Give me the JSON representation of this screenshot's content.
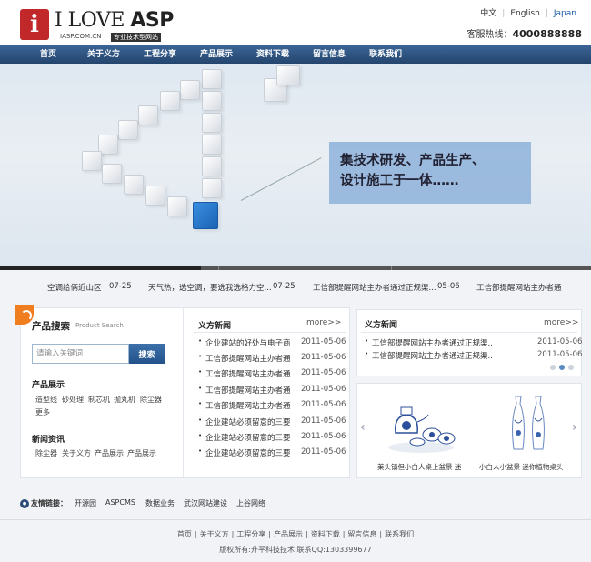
{
  "brand": {
    "logo_letter": "i",
    "logo_text_a": "I LOVE ",
    "logo_text_b": "ASP",
    "url": "IASP.COM.CN",
    "slogan": "专业技术型网站"
  },
  "languages": [
    "中文",
    "English",
    "Japan"
  ],
  "hotline": {
    "label": "客服热线：",
    "number": "4000888888"
  },
  "nav": [
    "首页",
    "关于义方",
    "工程分享",
    "产品展示",
    "资料下载",
    "留言信息",
    "联系我们"
  ],
  "banner": {
    "caption_line1": "集技术研发、产品生产、",
    "caption_line2": "设计施工于一体……",
    "progress": 0.34
  },
  "ticker": [
    {
      "t": "空调给俩近山区",
      "d": "07-25"
    },
    {
      "t": "天气热，选空调，要选我选格力空...",
      "d": "07-25"
    },
    {
      "t": "工信部提醒网站主办者通过正规渠...",
      "d": "05-06"
    },
    {
      "t": "工信部提醒网站主办者通"
    }
  ],
  "product_search": {
    "title": "产品搜索",
    "subtitle": "Product Search",
    "placeholder": "请输入关键词",
    "button": "搜索",
    "products_title": "产品展示",
    "products": [
      "造型线",
      "砂处理",
      "制芯机",
      "抛丸机",
      "除尘器",
      "更多"
    ],
    "news_title": "新闻资讯",
    "news_tags": [
      "除尘器",
      "关于义方",
      "产品展示",
      "产品展示"
    ]
  },
  "news": {
    "title": "义方新闻",
    "more": "more>>",
    "rows": [
      {
        "t": "企业建站的好处与电子商",
        "d": "2011-05-06"
      },
      {
        "t": "工信部提醒网站主办者通",
        "d": "2011-05-06"
      },
      {
        "t": "工信部提醒网站主办者通",
        "d": "2011-05-06"
      },
      {
        "t": "工信部提醒网站主办者通",
        "d": "2011-05-06"
      },
      {
        "t": "工信部提醒网站主办者通",
        "d": "2011-05-06"
      },
      {
        "t": "企业建站必须留意的三要",
        "d": "2011-05-06"
      },
      {
        "t": "企业建站必须留意的三要",
        "d": "2011-05-06"
      },
      {
        "t": "企业建站必须留意的三要",
        "d": "2011-05-06"
      }
    ]
  },
  "right_news": {
    "title": "义方新闻",
    "more": "more>>",
    "rows": [
      {
        "t": "工信部提醒网站主办者通过正规渠...",
        "d": "2011-05-06"
      },
      {
        "t": "工信部提醒网站主办者通过正规渠...",
        "d": "2011-05-06"
      }
    ]
  },
  "gallery": {
    "items": [
      "莱头镇但小白人桌上盆景 迷",
      "小白人小盆景 迷你植物桌头"
    ]
  },
  "links": {
    "label": "友情链接：",
    "items": [
      "开源园",
      "ASPCMS",
      "数据业务",
      "武汉网站建设",
      "上谷网络"
    ]
  },
  "footer": {
    "nav": [
      "首页",
      "关于义方",
      "工程分享",
      "产品展示",
      "资料下载",
      "留言信息",
      "联系我们"
    ],
    "copyright": "版权所有:升平科技技术 联系QQ:1303399677"
  },
  "colors": {
    "nav": "#2d5282",
    "accent": "#f07d1e",
    "logo_red": "#c0282a"
  }
}
